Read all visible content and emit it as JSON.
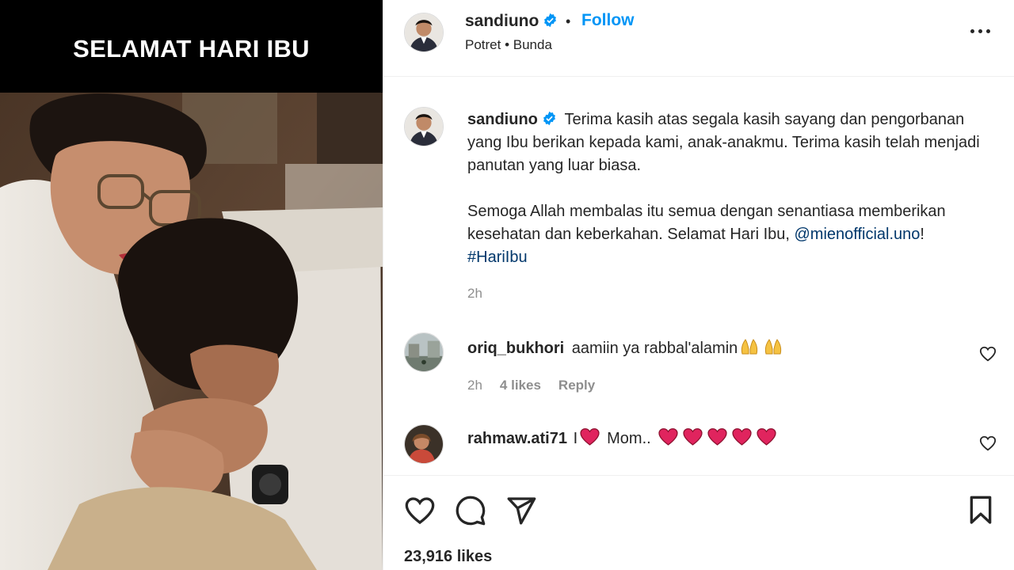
{
  "photo": {
    "banner_text": "SELAMAT HARI IBU"
  },
  "post": {
    "author": "sandiuno",
    "separator": "•",
    "follow_label": "Follow",
    "location": "Potret • Bunda",
    "caption_author": "sandiuno",
    "caption_p1": "Terima kasih atas segala kasih sayang dan pengorbanan yang Ibu berikan kepada kami, anak-anakmu. Terima kasih telah menjadi panutan yang luar biasa.",
    "caption_p2_text": "Semoga Allah membalas itu semua dengan senantiasa memberikan kesehatan dan keberkahan. Selamat Hari Ibu, ",
    "caption_mention": "@mienofficial.uno",
    "caption_p2_end": "!",
    "caption_hashtag": "#HariIbu",
    "caption_time": "2h",
    "likes": "23,916 likes"
  },
  "comments": [
    {
      "user": "oriq_bukhori",
      "text": "aamiin ya rabbal'alamin",
      "time": "2h",
      "likes": "4 likes",
      "reply": "Reply"
    },
    {
      "user": "rahmaw.ati71",
      "text_a": "I",
      "text_b": "Mom..",
      "icons": [
        "heart-emoji",
        "heart-emoji",
        "heart-emoji",
        "heart-emoji",
        "heart-emoji",
        "heart-emoji"
      ]
    }
  ],
  "icons": {
    "verified": "verified-badge-icon",
    "more": "more-options-icon",
    "like": "heart-icon",
    "comment": "comment-icon",
    "share": "send-icon",
    "save": "bookmark-icon"
  },
  "colors": {
    "link_blue": "#0095f6",
    "mention": "#00376b",
    "heart_red": "#e0245e",
    "banner_bg": "#000000"
  }
}
